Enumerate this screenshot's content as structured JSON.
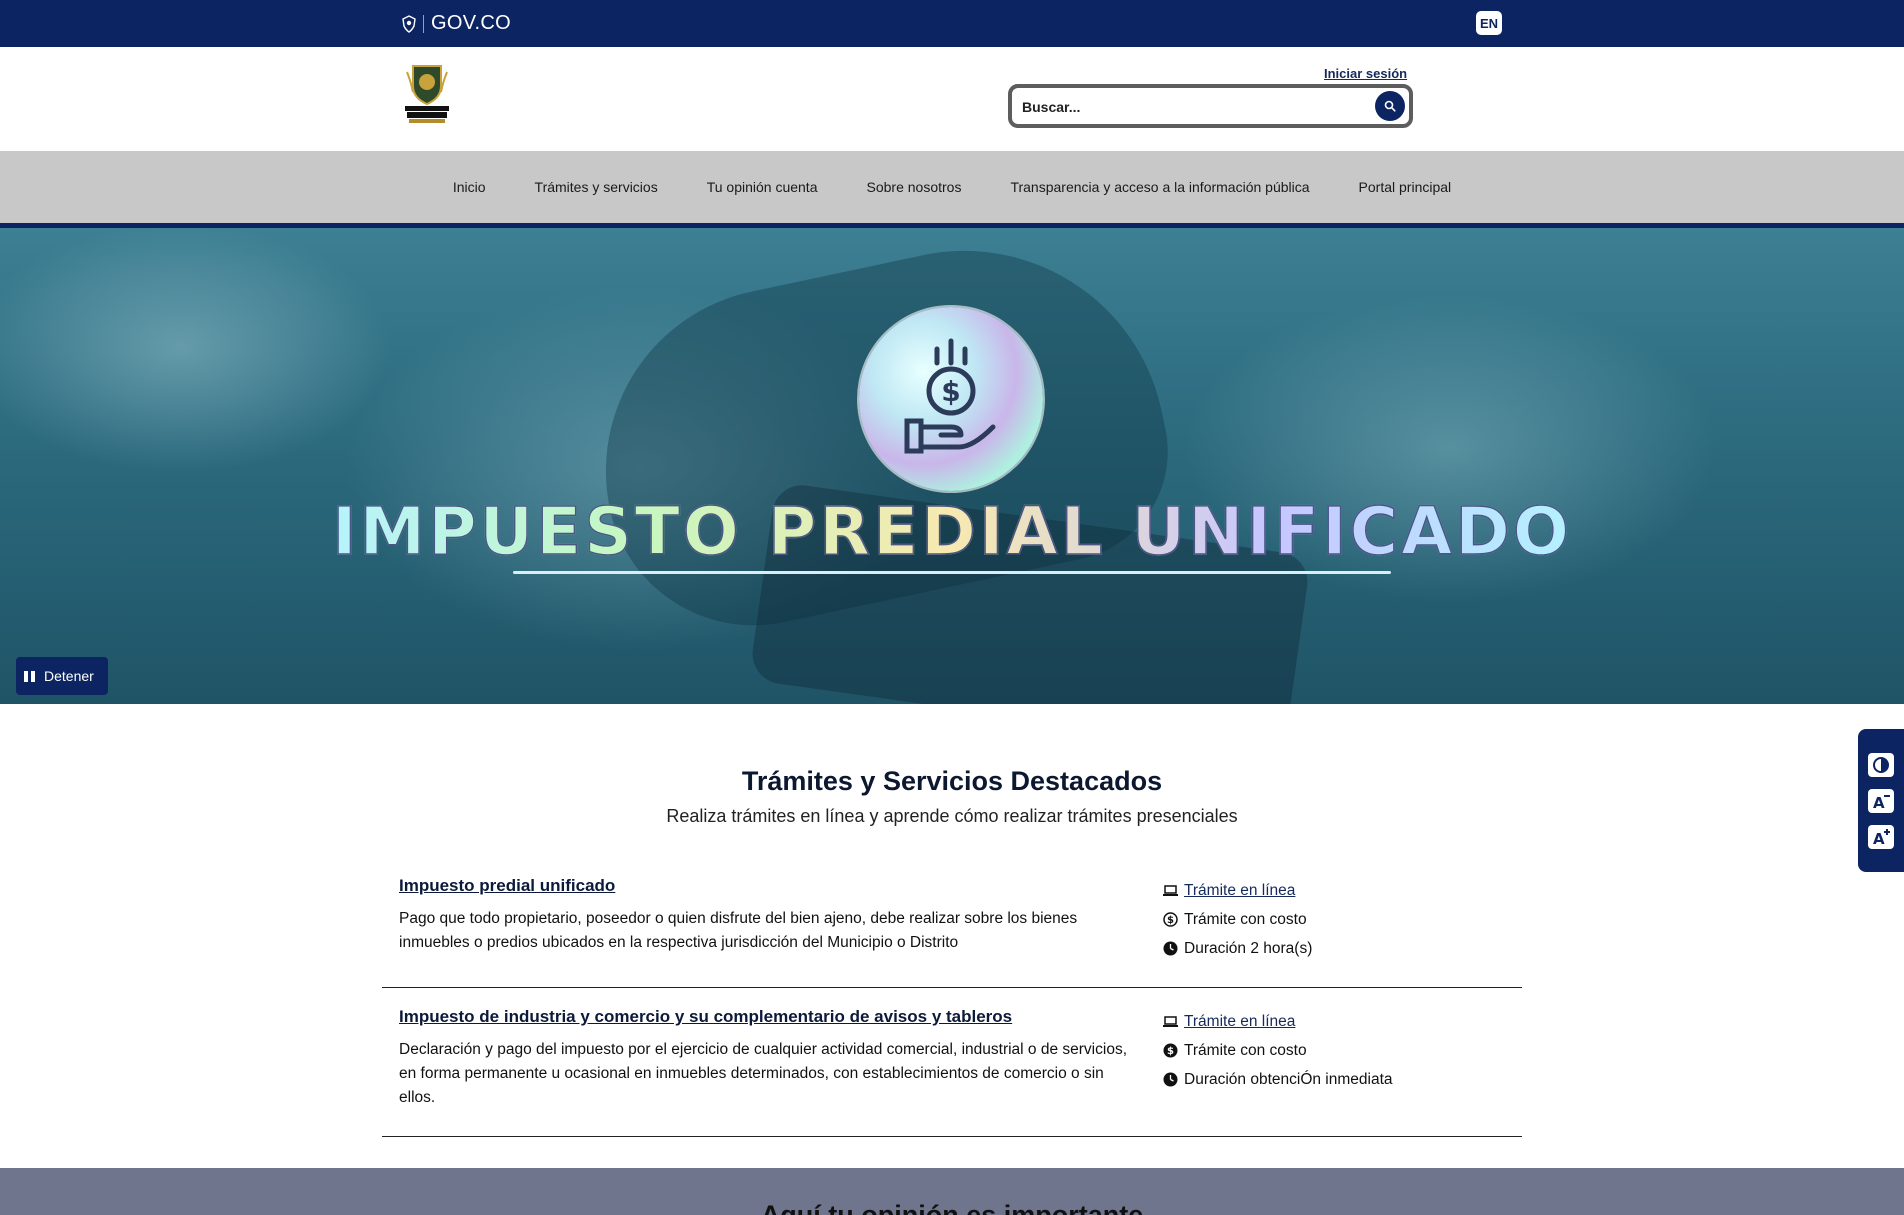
{
  "govbar": {
    "brand": "GOV.CO",
    "lang_button": "EN"
  },
  "header": {
    "crest_alt": "Alcaldía de Carmen de Apicalá",
    "login_label": "Iniciar sesión",
    "search_placeholder": "Buscar..."
  },
  "nav": {
    "items": [
      {
        "label": "Inicio"
      },
      {
        "label": "Trámites y servicios"
      },
      {
        "label": "Tu opinión cuenta"
      },
      {
        "label": "Sobre nosotros"
      },
      {
        "label": "Transparencia y acceso a la información pública"
      },
      {
        "label": "Portal principal"
      }
    ]
  },
  "hero": {
    "title": "IMPUESTO PREDIAL UNIFICADO",
    "pause_label": "Detener"
  },
  "featured": {
    "title": "Trámites y Servicios Destacados",
    "subtitle": "Realiza trámites en línea y aprende cómo realizar trámites presenciales",
    "items": [
      {
        "name": "Impuesto predial unificado",
        "description": "Pago que todo propietario, poseedor o quien disfrute del bien ajeno, debe realizar sobre los bienes inmuebles o predios ubicados en la respectiva jurisdicción del Municipio o Distrito",
        "mode": "Trámite en línea",
        "cost": "Trámite con costo",
        "duration": "Duración 2 hora(s)"
      },
      {
        "name": "Impuesto de industria y comercio y su complementario de avisos y tableros",
        "description": "Declaración y pago del impuesto por el ejercicio de cualquier actividad comercial, industrial o de servicios, en forma permanente u ocasional en inmuebles determinados, con establecimientos de comercio o sin ellos.",
        "mode": "Trámite en línea",
        "cost": "Trámite con costo",
        "duration": "Duración obtenciÓn inmediata"
      }
    ]
  },
  "bottom": {
    "title": "Aquí tu opinión es importante"
  },
  "colors": {
    "primary": "#0c2562",
    "nav_bg": "#c8c8c8",
    "bottom_band": "#6e758d"
  },
  "icons": {
    "gov": "gov-shield-icon",
    "search": "search-icon",
    "pause": "pause-icon",
    "laptop": "laptop-icon",
    "cost": "dollar-circle-icon",
    "clock": "clock-icon",
    "contrast": "contrast-icon",
    "font_down": "font-decrease-icon",
    "font_up": "font-increase-icon"
  }
}
